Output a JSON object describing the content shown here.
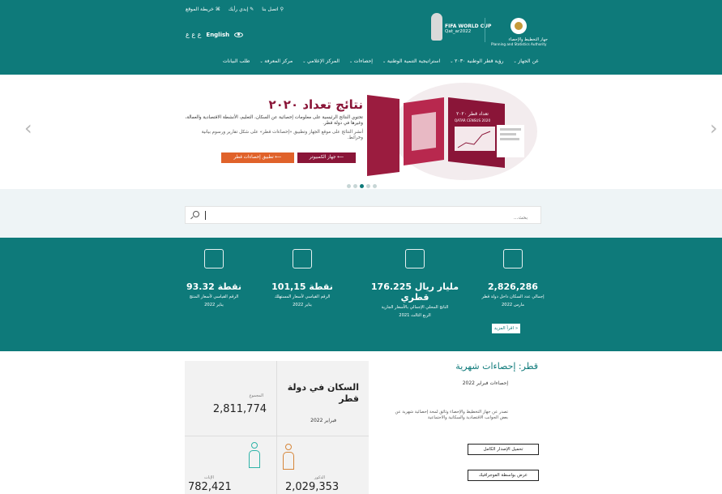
{
  "header": {
    "topbar": [
      "اتصل بنا",
      "إبدي رأيك",
      "خريطة الموقع"
    ],
    "font_size_controls": "ع ع ع",
    "language": "English",
    "psa_name_ar": "جهاز التخطيط والإحصاء",
    "psa_name_en": "Planning and Statistics Authority",
    "fifa_line1": "FIFA WORLD CUP",
    "fifa_line2": "Qat_ar2022",
    "nav": [
      "عن الجهاز",
      "رؤية قطر الوطنية ٢٠٣٠",
      "استراتيجية التنمية الوطنية",
      "إحصاءات",
      "المركز الإعلامي",
      "مركز المعرفة",
      "طلب البيانات"
    ]
  },
  "hero": {
    "title": "نتائج تعداد ٢٠٢٠",
    "desc1": "تحتوي النتائج الرئيسية على معلومات إحصائية عن السكان، التعليم، الأنشطة الاقتصادية والعمالة، وغيرها في دولة قطر.",
    "desc2": "أنشر النتائج على موقع الجهاز وتطبيق «إحصاءات قطر» على شكل تقارير ورسوم بيانية وخرائط.",
    "btn_pc": "جهاز الكمبيوتر",
    "btn_app": "تطبيق إحصاءات قطر",
    "banner_ar": "تعداد قطر ٢٠٢٠",
    "banner_en": "QATAR CENSUS 2020"
  },
  "search": {
    "placeholder": "بحث..."
  },
  "stats": {
    "items": [
      {
        "value": "2,826,286",
        "label": "إجمالي عدد السكان داخل دولة قطر",
        "date": "مارس 2022"
      },
      {
        "value": "176.225 مليار ريال قطري",
        "label": "الناتج المحلي الإجمالي بالأسعار الجارية",
        "date": "الربع الثالث 2021"
      },
      {
        "value": "101,15 نقطة",
        "label": "الرقم القياسي لأسعار المستهلك",
        "date": "يناير 2022"
      },
      {
        "value": "93.32 نقطة",
        "label": "الرقم القياسي لأسعار المنتج",
        "date": "يناير 2022"
      }
    ],
    "read_more": "اقرأ المزيد"
  },
  "monthly": {
    "title": "قطر: إحصاءات شهرية",
    "subtitle": "إحصاءات فبراير 2022",
    "desc": "تصدر عن جهاز التخطيط والإحصاء وثائق لمحة إحصائية شهرية عن بعض الجوانب الاقتصادية والسكانية والاجتماعية",
    "btn_download": "تحميل الإصدار الكامل",
    "btn_geo": "عرض بواسطة الفوجرافيك",
    "card": {
      "title": "السكان في دولة قطر",
      "date": "فبراير 2022",
      "total_label": "المجموع",
      "total": "2,811,774",
      "male_label": "الذكور",
      "male": "2,029,353",
      "female_label": "الإناث",
      "female": "782,421"
    }
  }
}
